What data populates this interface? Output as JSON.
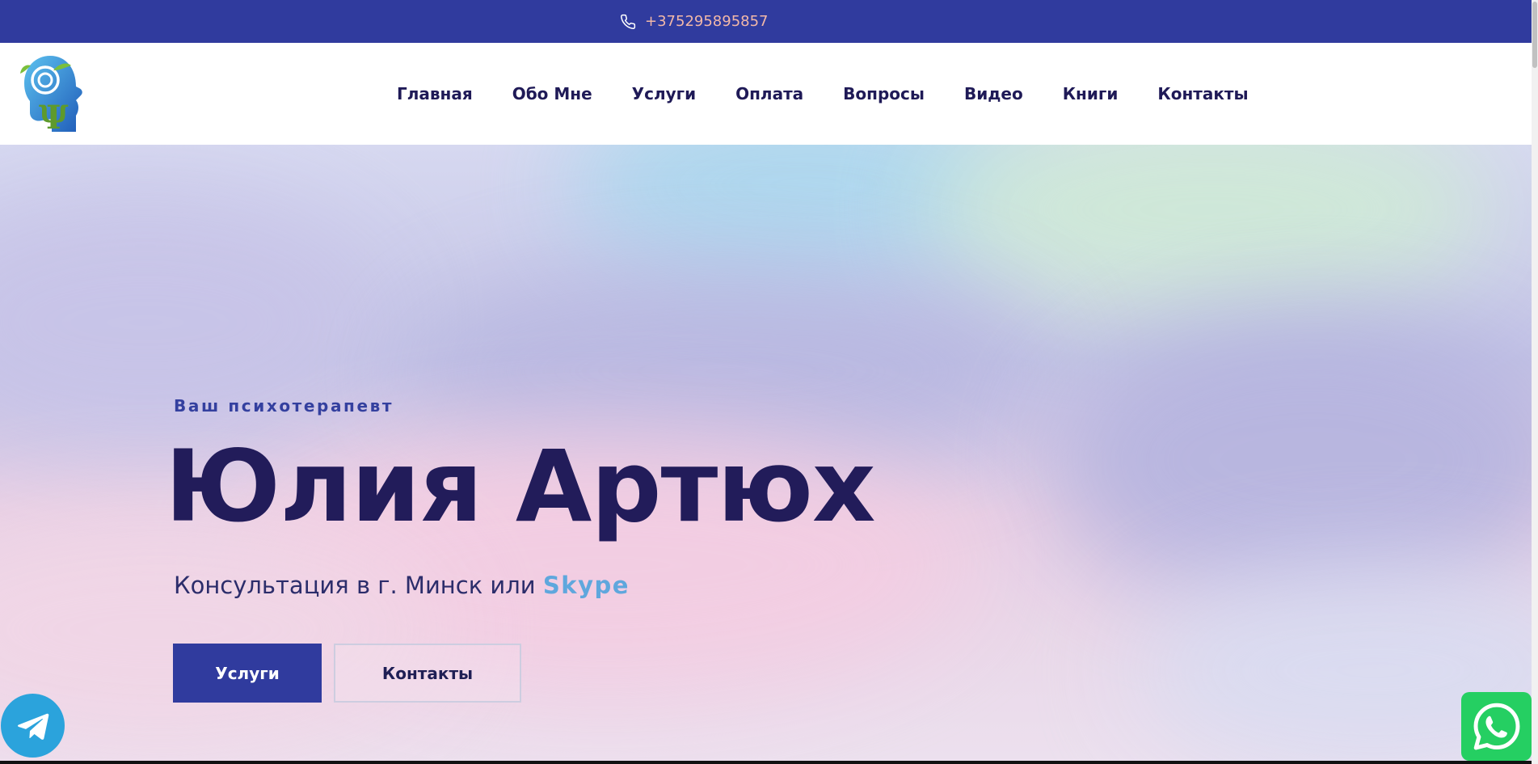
{
  "topbar": {
    "phone_icon": "phone-icon",
    "phone": "+375295895857"
  },
  "header": {
    "logo_icon": "psychology-head-logo",
    "nav": [
      "Главная",
      "Обо Мне",
      "Услуги",
      "Оплата",
      "Вопросы",
      "Видео",
      "Книги",
      "Контакты"
    ]
  },
  "hero": {
    "eyebrow": "Ваш психотерапевт",
    "title": "Юлия Артюх",
    "subtitle_prefix": "Консультация в г. Минск или ",
    "subtitle_accent": "Skype",
    "buttons": {
      "primary": "Услуги",
      "secondary": "Контакты"
    }
  },
  "floating": {
    "telegram_icon": "telegram-icon",
    "whatsapp_icon": "whatsapp-icon"
  },
  "colors": {
    "brand": "#303b9e",
    "title": "#221c5a",
    "accent": "#5fa7dd",
    "phone_text": "#f2b8a8",
    "telegram": "#2ba3dc",
    "whatsapp": "#25cf62"
  }
}
